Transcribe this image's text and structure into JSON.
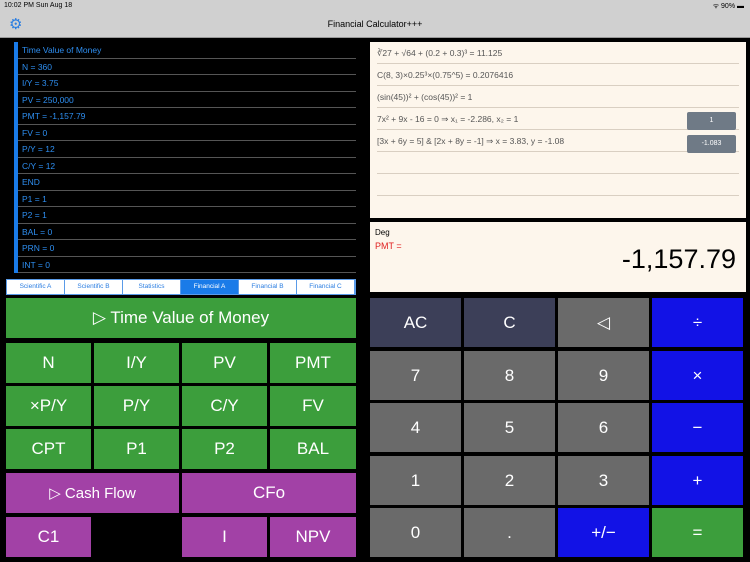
{
  "status": {
    "time": "10:02 PM  Sun Aug 18",
    "battery": "90%"
  },
  "nav": {
    "title": "Financial Calculator+++"
  },
  "list": [
    "Time Value of Money",
    "N = 360",
    "I/Y = 3.75",
    "PV = 250,000",
    "PMT = -1,157.79",
    "FV = 0",
    "P/Y = 12",
    "C/Y = 12",
    "END",
    "P1 = 1",
    "P2 = 1",
    "BAL = 0",
    "PRN = 0",
    "INT = 0"
  ],
  "tabs": [
    "Scientific A",
    "Scientific B",
    "Statistics",
    "Financial A",
    "Financial B",
    "Financial C"
  ],
  "active_tab": "Financial A",
  "left_keys": {
    "tvm": "▷  Time Value of Money",
    "n": "N",
    "iy": "I/Y",
    "pv": "PV",
    "pmt": "PMT",
    "xpy": "×P/Y",
    "py": "P/Y",
    "cy": "C/Y",
    "fv": "FV",
    "cpt": "CPT",
    "p1": "P1",
    "p2": "P2",
    "bal": "BAL",
    "cashflow": "▷  Cash Flow",
    "cfo": "CFo",
    "c1": "C1",
    "i": "I",
    "npv": "NPV"
  },
  "history": [
    "∛27 + √64 + (0.2 + 0.3)³ = 11.125",
    "C(8, 3)×0.25³×(0.75^5) = 0.2076416",
    "(sin(45))² + (cos(45))² = 1",
    "7x² + 9x - 16 = 0      ⇒      x₁ = -2.286, x₂ = 1",
    "[3x + 6y = 5]  &  [2x + 8y = -1] ⇒ x = 3.83, y = -1.08"
  ],
  "history_buttons": [
    "1",
    "-1.083"
  ],
  "display": {
    "mode": "Deg",
    "label": "PMT =",
    "value": "-1,157.79"
  },
  "right_keys": {
    "ac": "AC",
    "c": "C",
    "back": "◁",
    "div": "÷",
    "k7": "7",
    "k8": "8",
    "k9": "9",
    "mul": "×",
    "k4": "4",
    "k5": "5",
    "k6": "6",
    "sub": "−",
    "k1": "1",
    "k2": "2",
    "k3": "3",
    "add": "+",
    "k0": "0",
    "dot": ".",
    "neg": "+/−",
    "eq": "="
  }
}
